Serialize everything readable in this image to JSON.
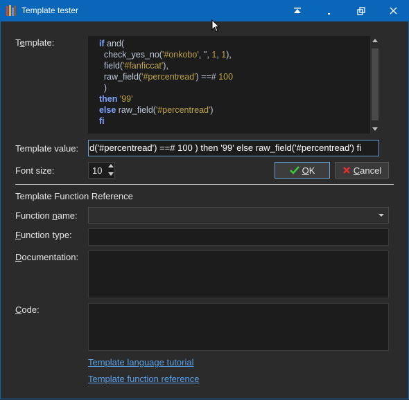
{
  "window": {
    "title": "Template tester"
  },
  "template": {
    "label_pre": "T",
    "label_u": "e",
    "label_post": "mplate:",
    "lines": [
      [
        {
          "t": "  if ",
          "c": "kw"
        },
        {
          "t": "and(",
          "c": "fn"
        }
      ],
      [
        {
          "t": "    check_yes_no(",
          "c": "fn"
        },
        {
          "t": "'#onkobo'",
          "c": "str"
        },
        {
          "t": ", '', ",
          "c": "fn"
        },
        {
          "t": "1",
          "c": "num"
        },
        {
          "t": ", ",
          "c": "fn"
        },
        {
          "t": "1",
          "c": "num"
        },
        {
          "t": "),",
          "c": "fn"
        }
      ],
      [
        {
          "t": "    field(",
          "c": "fn"
        },
        {
          "t": "'#fanficcat'",
          "c": "str"
        },
        {
          "t": "),",
          "c": "fn"
        }
      ],
      [
        {
          "t": "    raw_field(",
          "c": "fn"
        },
        {
          "t": "'#percentread'",
          "c": "str"
        },
        {
          "t": ") ==# ",
          "c": "fn"
        },
        {
          "t": "100",
          "c": "num"
        }
      ],
      [
        {
          "t": "    )",
          "c": "fn"
        }
      ],
      [
        {
          "t": "  then ",
          "c": "kw"
        },
        {
          "t": "'99'",
          "c": "str"
        }
      ],
      [
        {
          "t": "  else ",
          "c": "kw"
        },
        {
          "t": "raw_field(",
          "c": "fn"
        },
        {
          "t": "'#percentread'",
          "c": "str"
        },
        {
          "t": ")",
          "c": "fn"
        }
      ],
      [
        {
          "t": "  fi",
          "c": "kw"
        }
      ]
    ]
  },
  "template_value": {
    "label": "Template value:",
    "value": "d('#percentread') ==# 100 ) then '99' else raw_field('#percentread') fi"
  },
  "font_size": {
    "label": "Font size:",
    "value": "10"
  },
  "buttons": {
    "ok_u": "O",
    "ok_rest": "K",
    "cancel_u": "C",
    "cancel_rest": "ancel"
  },
  "reference": {
    "heading": "Template Function Reference",
    "function_name": {
      "pre": "Function ",
      "u": "n",
      "post": "ame:"
    },
    "function_type": {
      "u": "F",
      "post": "unction type:"
    },
    "documentation": {
      "u": "D",
      "post": "ocumentation:"
    },
    "code": {
      "u": "C",
      "post": "ode:"
    }
  },
  "links": {
    "tutorial": "Template language tutorial",
    "function_ref": "Template function reference"
  },
  "colors": {
    "titlebar": "#0a66b8",
    "background": "#2b2b2b",
    "link": "#5aa0e6",
    "keyword": "#7fa4ff",
    "string": "#bfa54a"
  }
}
